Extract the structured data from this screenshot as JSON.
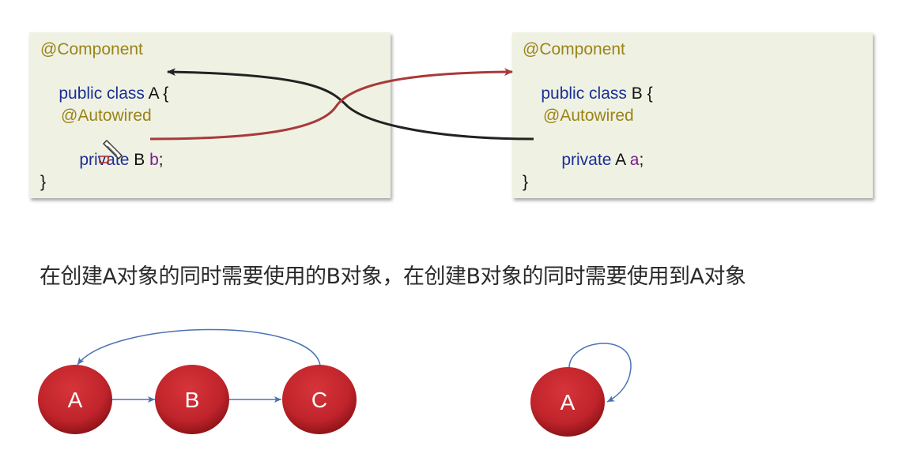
{
  "class_a": {
    "annotation": "@Component",
    "decl_keyword": "public class",
    "decl_name": "A {",
    "field_annotation": "@Autowired",
    "field_keyword": "private",
    "field_type": "B",
    "field_name": "b",
    "field_end": ";",
    "closing": "}"
  },
  "class_b": {
    "annotation": "@Component",
    "decl_keyword": "public class",
    "decl_name": "B {",
    "field_annotation": "@Autowired",
    "field_keyword": "private",
    "field_type": "A",
    "field_name": "a",
    "field_end": ";",
    "closing": "}"
  },
  "caption": "在创建A对象的同时需要使用的B对象，在创建B对象的同时需要使用到A对象",
  "chain_nodes": [
    "A",
    "B",
    "C"
  ],
  "self_node": "A",
  "colors": {
    "node_fill": "#c8232a",
    "arrow_blue": "#4a72b5",
    "arrow_red": "#a83a3a",
    "arrow_black": "#222222"
  }
}
